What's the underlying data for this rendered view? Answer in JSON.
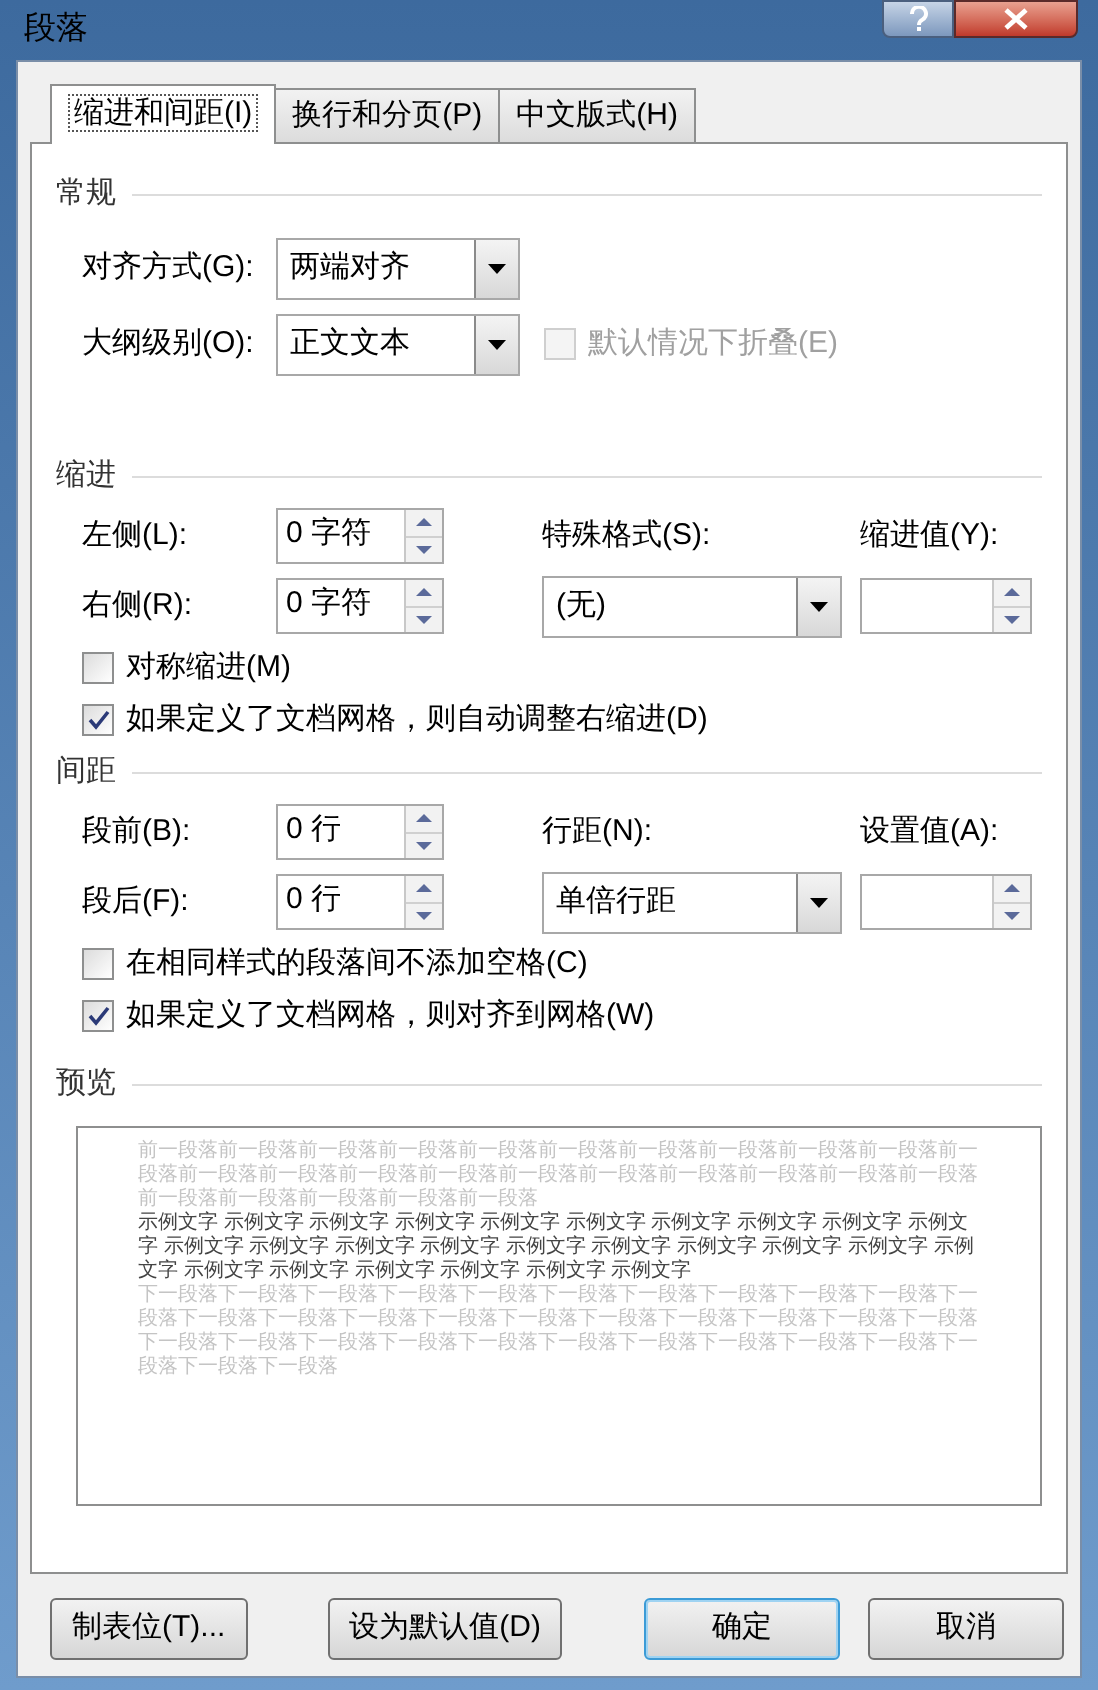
{
  "window": {
    "title": "段落"
  },
  "tabs": [
    {
      "label": "缩进和间距(I)",
      "selected": true
    },
    {
      "label": "换行和分页(P)",
      "selected": false
    },
    {
      "label": "中文版式(H)",
      "selected": false
    }
  ],
  "general": {
    "title": "常规",
    "alignment": {
      "label": "对齐方式(G):",
      "value": "两端对齐"
    },
    "outline_level": {
      "label": "大纲级别(O):",
      "value": "正文文本"
    },
    "collapse": {
      "label": "默认情况下折叠(E)",
      "checked": false,
      "disabled": true
    }
  },
  "indent": {
    "title": "缩进",
    "left": {
      "label": "左侧(L):",
      "value": "0 字符"
    },
    "right": {
      "label": "右侧(R):",
      "value": "0 字符"
    },
    "special": {
      "label": "特殊格式(S):",
      "value": "(无)"
    },
    "by": {
      "label": "缩进值(Y):"
    },
    "mirror": {
      "label": "对称缩进(M)",
      "checked": false,
      "disabled": false
    },
    "auto_adjust": {
      "label": "如果定义了文档网格，则自动调整右缩进(D)",
      "checked": true,
      "disabled": false
    }
  },
  "spacing": {
    "title": "间距",
    "before": {
      "label": "段前(B):",
      "value": "0 行"
    },
    "after": {
      "label": "段后(F):",
      "value": "0 行"
    },
    "line_spacing": {
      "label": "行距(N):",
      "value": "单倍行距"
    },
    "at": {
      "label": "设置值(A):"
    },
    "no_space": {
      "label": "在相同样式的段落间不添加空格(C)",
      "checked": false,
      "disabled": false
    },
    "snap_grid": {
      "label": "如果定义了文档网格，则对齐到网格(W)",
      "checked": true,
      "disabled": false
    }
  },
  "preview": {
    "title": "预览",
    "previous_text": "前一段落前一段落前一段落前一段落前一段落前一段落前一段落前一段落前一段落前一段落前一段落前一段落前一段落前一段落前一段落前一段落前一段落前一段落前一段落前一段落前一段落前一段落前一段落前一段落前一段落前一段落",
    "sample_text": "示例文字 示例文字 示例文字 示例文字 示例文字 示例文字 示例文字 示例文字 示例文字 示例文字 示例文字 示例文字 示例文字 示例文字 示例文字 示例文字 示例文字 示例文字 示例文字 示例文字 示例文字 示例文字 示例文字 示例文字 示例文字 示例文字",
    "next_text": "下一段落下一段落下一段落下一段落下一段落下一段落下一段落下一段落下一段落下一段落下一段落下一段落下一段落下一段落下一段落下一段落下一段落下一段落下一段落下一段落下一段落下一段落下一段落下一段落下一段落下一段落下一段落下一段落下一段落下一段落下一段落下一段落下一段落下一段落"
  },
  "buttons": [
    {
      "label": "制表位(T)...",
      "default": false
    },
    {
      "label": "设为默认值(D)",
      "default": false
    },
    {
      "label": "确定",
      "default": true
    },
    {
      "label": "取消",
      "default": false
    }
  ]
}
